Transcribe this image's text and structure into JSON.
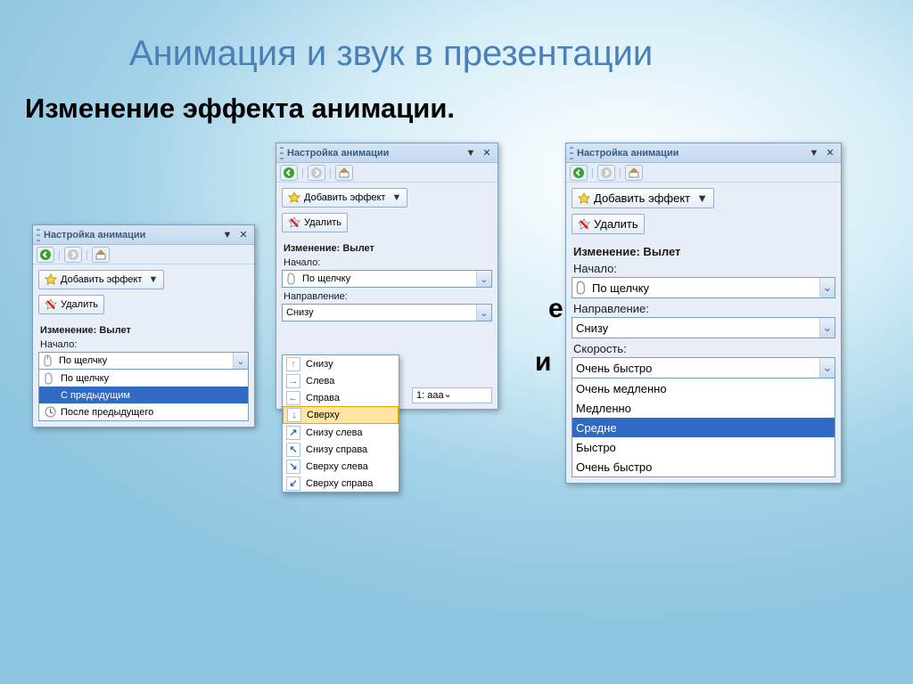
{
  "slide": {
    "title": "Анимация и звук в презентации",
    "subtitle": "Изменение эффекта анимации."
  },
  "bg_hints": [
    "и.",
    "е",
    "и"
  ],
  "panel_common": {
    "title": "Настройка анимации",
    "add_effect": "Добавить эффект",
    "remove": "Удалить",
    "modify": "Изменение: Вылет",
    "start_label": "Начало:",
    "direction_label": "Направление:",
    "speed_label": "Скорость:"
  },
  "panel1": {
    "start_value": "По щелчку",
    "start_options": [
      {
        "label": "По щелчку",
        "icon": "mouse"
      },
      {
        "label": "С предыдущим",
        "icon": "blank",
        "selected": true
      },
      {
        "label": "После предыдущего",
        "icon": "clock"
      }
    ]
  },
  "panel2": {
    "start_value": "По щелчку",
    "direction_value": "Снизу",
    "direction_options": [
      {
        "label": "Снизу",
        "arrow": "↑",
        "cls": "orange"
      },
      {
        "label": "Слева",
        "arrow": "→"
      },
      {
        "label": "Справа",
        "arrow": "←"
      },
      {
        "label": "Сверху",
        "arrow": "↓",
        "hover": true
      },
      {
        "label": "Снизу слева",
        "arrow": "↗"
      },
      {
        "label": "Снизу справа",
        "arrow": "↖"
      },
      {
        "label": "Сверху слева",
        "arrow": "↘"
      },
      {
        "label": "Сверху справа",
        "arrow": "↙"
      }
    ],
    "extra_item": "1: aaa"
  },
  "panel3": {
    "start_value": "По щелчку",
    "direction_value": "Снизу",
    "speed_value": "Очень быстро",
    "speed_options": [
      {
        "label": "Очень медленно"
      },
      {
        "label": "Медленно"
      },
      {
        "label": "Средне",
        "selected": true
      },
      {
        "label": "Быстро"
      },
      {
        "label": "Очень быстро"
      }
    ]
  },
  "colors": {
    "accent": "#316ac5",
    "panel_bg": "#e4ecf7",
    "border": "#7b9ebd"
  }
}
